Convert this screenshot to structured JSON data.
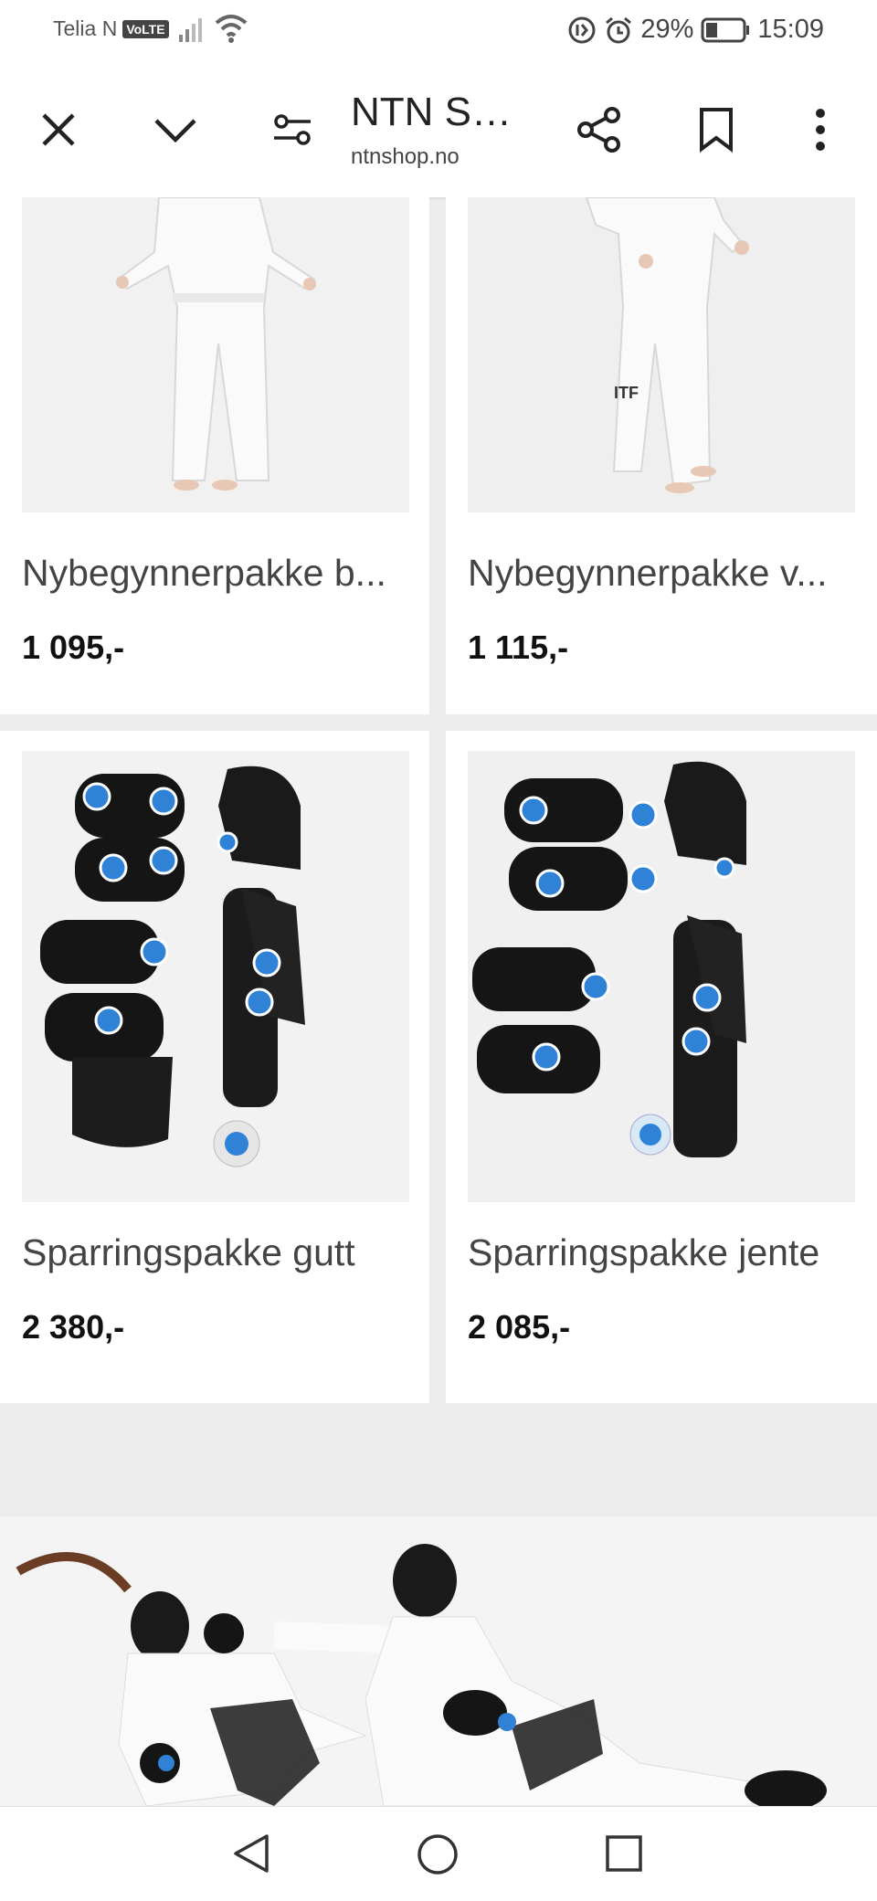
{
  "status_bar": {
    "carrier": "Telia N",
    "volte": "VoLTE",
    "battery": "29%",
    "time": "15:09"
  },
  "toolbar": {
    "title": "NTN Sh…",
    "url": "ntnshop.no"
  },
  "products": [
    {
      "name": "Nybegynnerpakke b...",
      "price": "1 095,-"
    },
    {
      "name": "Nybegynnerpakke v...",
      "price": "1 115,-"
    },
    {
      "name": "Sparringspakke gutt",
      "price": "2 380,-"
    },
    {
      "name": "Sparringspakke jente",
      "price": "2 085,-"
    }
  ],
  "icons": {
    "close": "close-icon",
    "collapse": "chevron-down-icon",
    "settings": "tune-icon",
    "share": "share-icon",
    "bookmark": "bookmark-icon",
    "menu": "more-vert-icon",
    "back": "back-nav-icon",
    "home": "home-nav-icon",
    "recents": "recents-nav-icon"
  }
}
